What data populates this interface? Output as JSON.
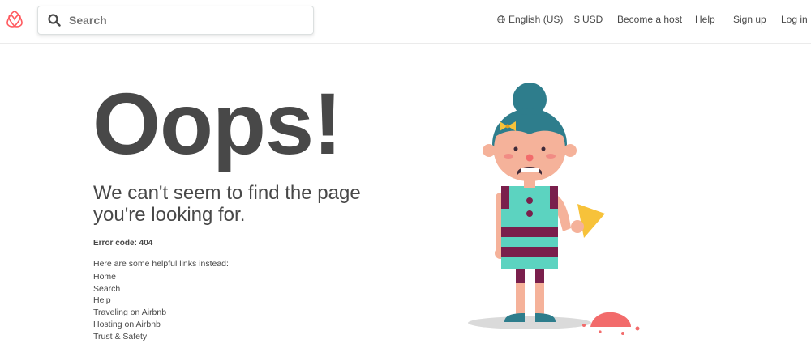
{
  "header": {
    "logo_name": "airbnb-logo",
    "brand_color": "#FF5A5F",
    "search_placeholder": "Search",
    "nav": {
      "language": "English (US)",
      "currency": "$ USD",
      "become_host": "Become a host",
      "help": "Help",
      "sign_up": "Sign up",
      "log_in": "Log in"
    }
  },
  "main": {
    "title": "Oops!",
    "subtitle": "We can't seem to find the page you're looking for.",
    "error_code": "Error code: 404",
    "links_intro": "Here are some helpful links instead:",
    "links": [
      "Home",
      "Search",
      "Help",
      "Traveling on Airbnb",
      "Hosting on Airbnb",
      "Trust & Safety"
    ]
  },
  "illustration": {
    "name": "sad-girl-dropped-ice-cream",
    "colors": {
      "hair": "#2E7D8C",
      "skin": "#F5B29A",
      "dress_top": "#5CD3C0",
      "dress_stripe": "#7A1F4C",
      "cone": "#F7C23A",
      "ice_cream": "#F26B6B",
      "shadow": "#DADADA"
    }
  }
}
